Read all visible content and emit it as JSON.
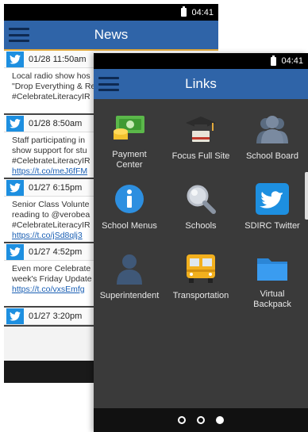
{
  "back_screen": {
    "status_time": "04:41",
    "title": "News",
    "items": [
      {
        "date": "01/28 11:50am",
        "lines": [
          "Local radio show hos",
          "\"Drop Everything & Re",
          "#CelebrateLiteracyIR"
        ],
        "link": ""
      },
      {
        "date": "01/28 8:50am",
        "lines": [
          "Staff participating in",
          "show support for stu",
          "#CelebrateLiteracyIR"
        ],
        "link": "https://t.co/meJ6fFM"
      },
      {
        "date": "01/27 6:15pm",
        "lines": [
          "Senior Class Volunte",
          "reading to @verobea",
          "#CelebrateLiteracyIR"
        ],
        "link": "https://t.co/jSd8qlj3"
      },
      {
        "date": "01/27 4:52pm",
        "lines": [
          "Even more Celebrate",
          "week's Friday Update"
        ],
        "link": "https://t.co/vxsEmfg"
      },
      {
        "date": "01/27 3:20pm",
        "lines": [],
        "link": ""
      }
    ]
  },
  "front_screen": {
    "status_time": "04:41",
    "title": "Links",
    "tiles": [
      {
        "label": "Payment\nCenter",
        "icon": "money-icon"
      },
      {
        "label": "Focus Full Site",
        "icon": "graduation-icon"
      },
      {
        "label": "School Board",
        "icon": "people-icon"
      },
      {
        "label": "School Menus",
        "icon": "info-icon"
      },
      {
        "label": "Schools",
        "icon": "magnifier-icon"
      },
      {
        "label": "SDIRC Twitter",
        "icon": "twitter-icon"
      },
      {
        "label": "Superintendent",
        "icon": "person-icon"
      },
      {
        "label": "Transportation",
        "icon": "bus-icon"
      },
      {
        "label": "Virtual\nBackpack",
        "icon": "folder-icon"
      }
    ],
    "page_indicator": {
      "count": 3,
      "active": 3
    }
  },
  "colors": {
    "appbar": "#2f64a8",
    "twitter": "#1d8fe0",
    "accent": "#e2a93c"
  }
}
